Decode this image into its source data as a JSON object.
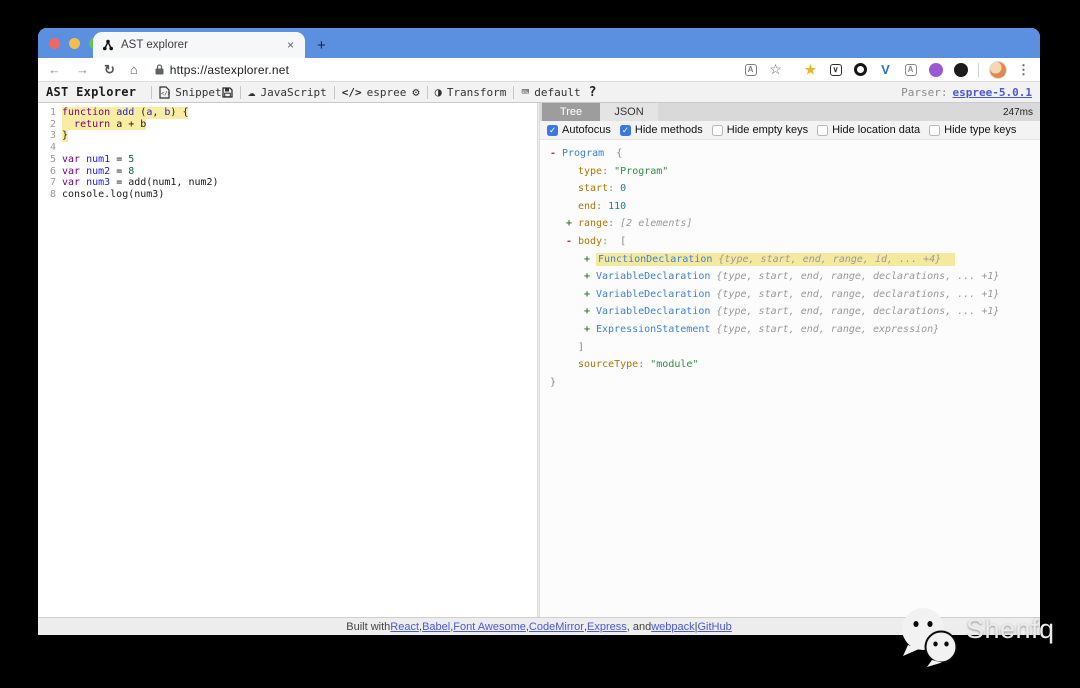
{
  "browser": {
    "tab_title": "AST explorer",
    "close_tab": "×",
    "new_tab_plus": "+",
    "url": "https://astexplorer.net",
    "nav": {
      "back": "←",
      "forward": "→",
      "refresh": "↻",
      "home": "⌂"
    },
    "menu_dots": "⋮",
    "theme_color": "#5b90e0",
    "omnibox_icons": [
      {
        "name": "translate-icon",
        "glyph": "A",
        "color": "#7a7f87"
      },
      {
        "name": "bookmark-star-icon",
        "glyph": "☆",
        "color": "#5f6368"
      }
    ],
    "extensions": [
      {
        "name": "star-extension-icon",
        "shape": "glyph",
        "glyph": "★",
        "color": "#f0b429"
      },
      {
        "name": "pocket-extension-icon",
        "shape": "square",
        "glyph": "∨",
        "color": "#2d2d2d"
      },
      {
        "name": "record-extension-icon",
        "shape": "ring",
        "glyph": "",
        "color": "#151515"
      },
      {
        "name": "vue-extension-icon",
        "shape": "glyph",
        "glyph": "V",
        "color": "#2f6fd8"
      },
      {
        "name": "ime-extension-icon",
        "shape": "square",
        "glyph": "A",
        "color": "#8a8a8a"
      },
      {
        "name": "purple-extension-icon",
        "shape": "dot",
        "glyph": "",
        "color": "#9b59d0"
      },
      {
        "name": "face-extension-icon",
        "shape": "dot",
        "glyph": "",
        "color": "#1b1b1b"
      }
    ]
  },
  "toolbar": {
    "logo": "AST Explorer",
    "buttons": {
      "snippet": "Snippet",
      "category": "JavaScript",
      "parser": "espree",
      "transform": "Transform",
      "keybinding": "default",
      "help": "?"
    },
    "icons": {
      "code_tag": "</>",
      "toggle": "◑",
      "keyboard": "⌨",
      "gear": "⚙",
      "cloud": "☁"
    },
    "parser_info": {
      "label": "Parser:",
      "link": "espree-5.0.1"
    }
  },
  "editor": {
    "lines": [
      {
        "n": "1",
        "hl": true,
        "seg": [
          [
            "kw",
            "function"
          ],
          [
            "pl",
            " "
          ],
          [
            "def",
            "add"
          ],
          [
            "pl",
            " ("
          ],
          [
            "def",
            "a"
          ],
          [
            "pl",
            ", "
          ],
          [
            "def",
            "b"
          ],
          [
            "pl",
            ") {"
          ]
        ]
      },
      {
        "n": "2",
        "hl": true,
        "seg": [
          [
            "pl",
            "  "
          ],
          [
            "kw",
            "return"
          ],
          [
            "pl",
            " a + b"
          ]
        ]
      },
      {
        "n": "3",
        "hl": true,
        "seg": [
          [
            "pl",
            "}"
          ]
        ]
      },
      {
        "n": "4",
        "hl": false,
        "seg": []
      },
      {
        "n": "5",
        "hl": false,
        "seg": [
          [
            "kw",
            "var"
          ],
          [
            "pl",
            " "
          ],
          [
            "def",
            "num1"
          ],
          [
            "pl",
            " = "
          ],
          [
            "num",
            "5"
          ]
        ]
      },
      {
        "n": "6",
        "hl": false,
        "seg": [
          [
            "kw",
            "var"
          ],
          [
            "pl",
            " "
          ],
          [
            "def",
            "num2"
          ],
          [
            "pl",
            " = "
          ],
          [
            "num",
            "8"
          ]
        ]
      },
      {
        "n": "7",
        "hl": false,
        "seg": [
          [
            "kw",
            "var"
          ],
          [
            "pl",
            " "
          ],
          [
            "def",
            "num3"
          ],
          [
            "pl",
            " = add(num1, num2)"
          ]
        ]
      },
      {
        "n": "8",
        "hl": false,
        "seg": [
          [
            "pl",
            "console.log(num3)"
          ]
        ]
      }
    ]
  },
  "tree_panel": {
    "tabs": [
      {
        "label": "Tree",
        "active": true
      },
      {
        "label": "JSON",
        "active": false
      }
    ],
    "time": "247ms",
    "options": [
      {
        "label": "Autofocus",
        "checked": true
      },
      {
        "label": "Hide methods",
        "checked": true
      },
      {
        "label": "Hide empty keys",
        "checked": false
      },
      {
        "label": "Hide location data",
        "checked": false
      },
      {
        "label": "Hide type keys",
        "checked": false
      }
    ],
    "rows": [
      {
        "pad": 2,
        "toggle": "-",
        "hl": false,
        "seg": [
          [
            "node",
            "Program"
          ],
          [
            "punct",
            "  {"
          ]
        ]
      },
      {
        "pad": 30,
        "toggle": "",
        "hl": false,
        "seg": [
          [
            "key",
            "type"
          ],
          [
            "punct",
            ": "
          ],
          [
            "str",
            "\"Program\""
          ]
        ]
      },
      {
        "pad": 30,
        "toggle": "",
        "hl": false,
        "seg": [
          [
            "key",
            "start"
          ],
          [
            "punct",
            ": "
          ],
          [
            "num",
            "0"
          ]
        ]
      },
      {
        "pad": 30,
        "toggle": "",
        "hl": false,
        "seg": [
          [
            "key",
            "end"
          ],
          [
            "punct",
            ": "
          ],
          [
            "num",
            "110"
          ]
        ]
      },
      {
        "pad": 18,
        "toggle": "+",
        "hl": false,
        "seg": [
          [
            "key",
            "range"
          ],
          [
            "punct",
            ": "
          ],
          [
            "sum",
            "[2 elements]"
          ]
        ]
      },
      {
        "pad": 18,
        "toggle": "-",
        "hl": false,
        "seg": [
          [
            "key",
            "body"
          ],
          [
            "punct",
            ":  ["
          ]
        ]
      },
      {
        "pad": 36,
        "toggle": "+",
        "hl": true,
        "seg": [
          [
            "node",
            "FunctionDeclaration"
          ],
          [
            "sum",
            " {type, start, end, range, id, ... +4}"
          ]
        ]
      },
      {
        "pad": 36,
        "toggle": "+",
        "hl": false,
        "seg": [
          [
            "node",
            "VariableDeclaration"
          ],
          [
            "sum",
            " {type, start, end, range, declarations, ... +1}"
          ]
        ]
      },
      {
        "pad": 36,
        "toggle": "+",
        "hl": false,
        "seg": [
          [
            "node",
            "VariableDeclaration"
          ],
          [
            "sum",
            " {type, start, end, range, declarations, ... +1}"
          ]
        ]
      },
      {
        "pad": 36,
        "toggle": "+",
        "hl": false,
        "seg": [
          [
            "node",
            "VariableDeclaration"
          ],
          [
            "sum",
            " {type, start, end, range, declarations, ... +1}"
          ]
        ]
      },
      {
        "pad": 36,
        "toggle": "+",
        "hl": false,
        "seg": [
          [
            "node",
            "ExpressionStatement"
          ],
          [
            "sum",
            " {type, start, end, range, expression}"
          ]
        ]
      },
      {
        "pad": 30,
        "toggle": "",
        "hl": false,
        "seg": [
          [
            "punct",
            "]"
          ]
        ]
      },
      {
        "pad": 30,
        "toggle": "",
        "hl": false,
        "seg": [
          [
            "key",
            "sourceType"
          ],
          [
            "punct",
            ": "
          ],
          [
            "str",
            "\"module\""
          ]
        ]
      },
      {
        "pad": 2,
        "toggle": "",
        "hl": false,
        "seg": [
          [
            "punct",
            "}"
          ]
        ]
      }
    ]
  },
  "footer": {
    "segments": [
      {
        "text": "Built with ",
        "link": false
      },
      {
        "text": "React",
        "link": true
      },
      {
        "text": ", ",
        "link": false
      },
      {
        "text": "Babel",
        "link": true
      },
      {
        "text": ", ",
        "link": false
      },
      {
        "text": "Font Awesome",
        "link": true
      },
      {
        "text": ", ",
        "link": false
      },
      {
        "text": "CodeMirror",
        "link": true
      },
      {
        "text": ", ",
        "link": false
      },
      {
        "text": "Express",
        "link": true
      },
      {
        "text": ", and ",
        "link": false
      },
      {
        "text": "webpack",
        "link": true
      },
      {
        "text": " | ",
        "link": false
      },
      {
        "text": "GitHub",
        "link": true
      }
    ]
  },
  "watermark": {
    "text": "Shenfq"
  },
  "colors": {
    "accent_blue": "#5b90e0",
    "highlight_yellow": "#f8eda2",
    "link_blue": "#4a5ad4"
  }
}
